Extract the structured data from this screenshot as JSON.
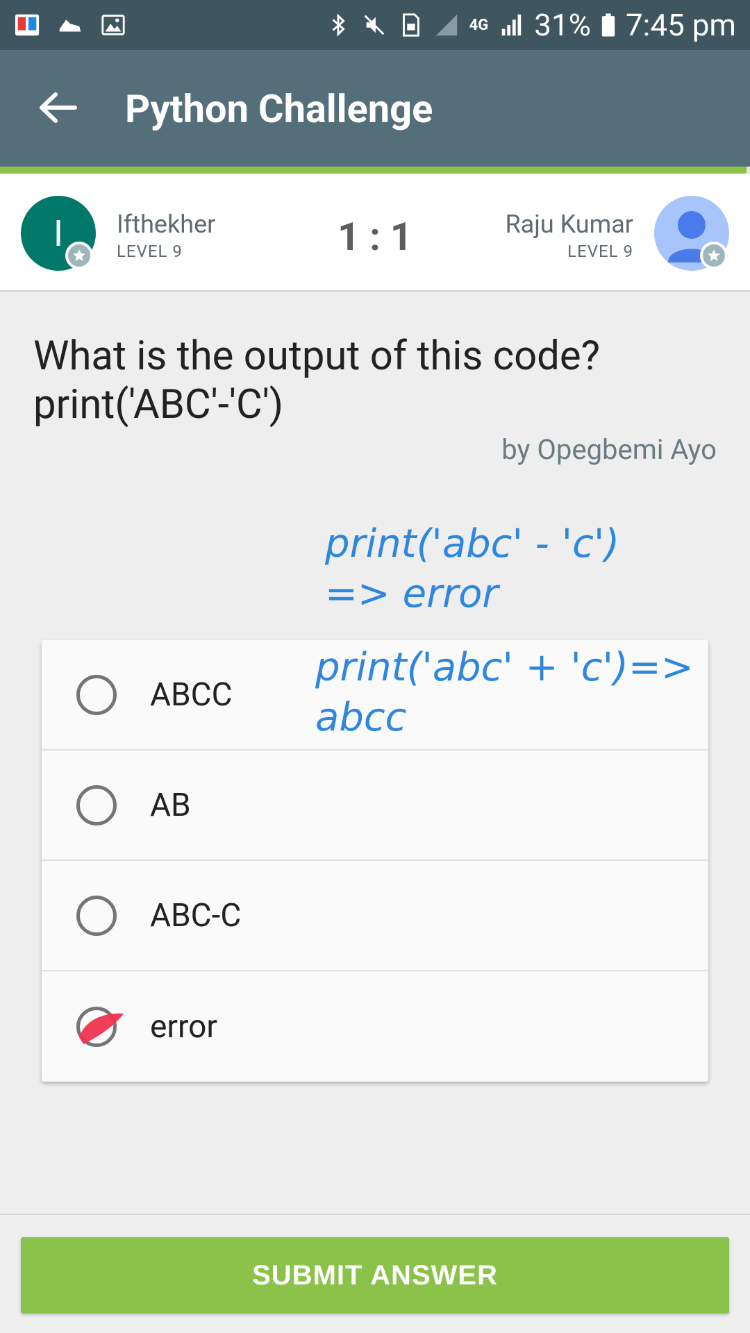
{
  "status_bar": {
    "battery": "31%",
    "time": "7:45 pm",
    "network_label": "4G"
  },
  "app_bar": {
    "title": "Python Challenge"
  },
  "progress": {
    "fraction": 0.995
  },
  "players": {
    "left": {
      "initial": "I",
      "name": "Ifthekher",
      "level": "LEVEL 9"
    },
    "right": {
      "name": "Raju Kumar",
      "level": "LEVEL 9"
    },
    "score": "1 : 1"
  },
  "question": {
    "line1": "What is the output of this code?",
    "line2": "print('ABC'-'C')",
    "author": "by Opegbemi Ayo"
  },
  "annotations": {
    "note1_line1": "print('abc' - 'c')",
    "note1_line2": "=> error",
    "note2_line1": "print('abc' + 'c')=>",
    "note2_line2": "abcc"
  },
  "options": [
    {
      "label": "ABCC",
      "selected": false
    },
    {
      "label": "AB",
      "selected": false
    },
    {
      "label": "ABC-C",
      "selected": false
    },
    {
      "label": "error",
      "selected": true
    }
  ],
  "submit_label": "SUBMIT ANSWER",
  "colors": {
    "status_bar": "#3f5560",
    "app_bar": "#546e7a",
    "accent_green": "#8bc34a",
    "avatar_left": "#00796b",
    "avatar_right": "#a7c4fb",
    "handwriting_blue": "#2e86de"
  }
}
